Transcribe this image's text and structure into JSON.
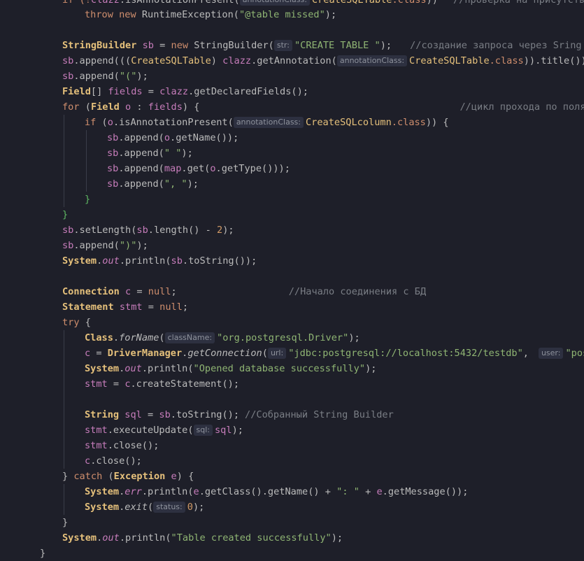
{
  "lines": {
    "l0": [
      "if (!",
      "clazz",
      ".isAnnotationPresent(",
      "annotationClass:",
      "CreateSQLTable",
      ".class",
      "))",
      "//проверка на присутствие"
    ],
    "l1": [
      "throw",
      " ",
      "new",
      " RuntimeException(",
      "\"@table missed\"",
      ");"
    ],
    "l3": [
      "StringBuilder",
      " ",
      "sb",
      " = ",
      "new",
      " StringBuilder(",
      "str:",
      "\"CREATE TABLE \"",
      ");",
      "//создание запроса через Sring Bu"
    ],
    "l4": [
      "sb",
      ".append(((",
      "CreateSQLTable",
      ") ",
      "clazz",
      ".getAnnotation(",
      "annotationClass:",
      "CreateSQLTable",
      ".class",
      ")).title());"
    ],
    "l5": [
      "sb",
      ".append(",
      "\"(\"",
      ");"
    ],
    "l6": [
      "Field",
      "[] ",
      "fields",
      " = ",
      "clazz",
      ".getDeclaredFields();"
    ],
    "l7": [
      "for",
      " (",
      "Field",
      " ",
      "o",
      " : ",
      "fields",
      ") {",
      "//цикл прохода по поля"
    ],
    "l8": [
      "if",
      " (",
      "o",
      ".isAnnotationPresent(",
      "annotationClass:",
      "CreateSQLcolumn",
      ".class",
      ")) {"
    ],
    "l9": [
      "sb",
      ".append(",
      "o",
      ".getName());"
    ],
    "l10": [
      "sb",
      ".append(",
      "\" \"",
      ");"
    ],
    "l11": [
      "sb",
      ".append(",
      "map",
      ".get(",
      "o",
      ".getType()));"
    ],
    "l12": [
      "sb",
      ".append(",
      "\", \"",
      ");"
    ],
    "l13": [
      "}"
    ],
    "l14": [
      "}"
    ],
    "l15": [
      "sb",
      ".setLength(",
      "sb",
      ".length() - ",
      "2",
      ");"
    ],
    "l16": [
      "sb",
      ".append(",
      "\")\"",
      ");"
    ],
    "l17": [
      "System",
      ".",
      "out",
      ".println(",
      "sb",
      ".toString());"
    ],
    "l19": [
      "Connection",
      " ",
      "c",
      " = ",
      "null",
      ";",
      "//Начало соединения с БД"
    ],
    "l20": [
      "Statement",
      " ",
      "stmt",
      " = ",
      "null",
      ";"
    ],
    "l21": [
      "try",
      " {"
    ],
    "l22": [
      "Class",
      ".",
      "forName",
      "(",
      "className:",
      "\"org.postgresql.Driver\"",
      ");"
    ],
    "l23": [
      "c",
      " = ",
      "DriverManager",
      ".",
      "getConnection",
      "(",
      "url:",
      "\"jdbc:postgresql://localhost:5432/testdb\"",
      ",",
      "user:",
      "\"postg"
    ],
    "l24": [
      "System",
      ".",
      "out",
      ".println(",
      "\"Opened database successfully\"",
      ");"
    ],
    "l25": [
      "stmt",
      " = ",
      "c",
      ".createStatement();"
    ],
    "l27": [
      "String",
      " ",
      "sql",
      " = ",
      "sb",
      ".toString();",
      "//Собранный String Builder"
    ],
    "l28": [
      "stmt",
      ".executeUpdate(",
      "sql:",
      "sql",
      ");"
    ],
    "l29": [
      "stmt",
      ".close();"
    ],
    "l30": [
      "c",
      ".close();"
    ],
    "l31": [
      "} ",
      "catch",
      " (",
      "Exception",
      " ",
      "e",
      ") {"
    ],
    "l32": [
      "System",
      ".",
      "err",
      ".println(",
      "e",
      ".getClass().getName() + ",
      "\": \"",
      " + ",
      "e",
      ".getMessage());"
    ],
    "l33": [
      "System",
      ".",
      "exit",
      "(",
      "status:",
      "0",
      ");"
    ],
    "l34": [
      "}"
    ],
    "l35": [
      "System",
      ".",
      "out",
      ".println(",
      "\"Table created successfully\"",
      ");"
    ],
    "l36": [
      "}"
    ]
  }
}
